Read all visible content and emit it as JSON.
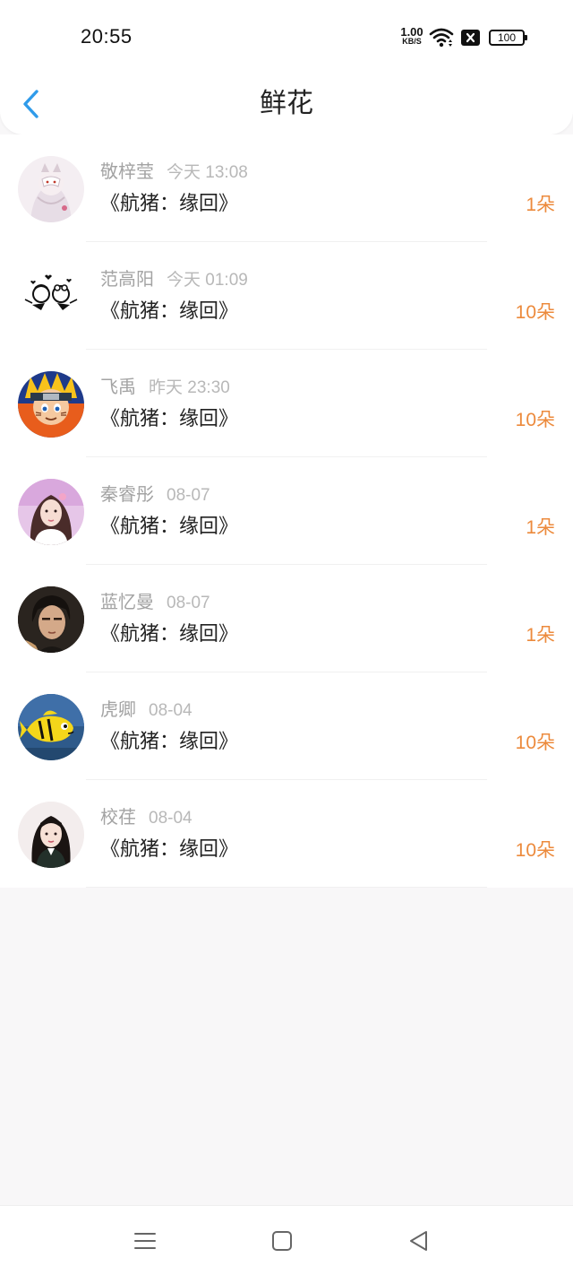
{
  "status_bar": {
    "time": "20:55",
    "net_speed_value": "1.00",
    "net_speed_unit": "KB/S",
    "battery": "100",
    "icons": [
      "wifi-icon",
      "sim-no-signal-icon",
      "battery-icon"
    ]
  },
  "header": {
    "title": "鲜花",
    "back_icon": "chevron-left-icon"
  },
  "colors": {
    "accent": "#2f9bea",
    "count": "#ec8a3c",
    "title_text": "#222222",
    "meta_text": "#a3a3a3",
    "background": "#f8f7f8"
  },
  "items": [
    {
      "name": "敬梓莹",
      "time": "今天 13:08",
      "title": "《航猪：缘回》",
      "count": "1朵",
      "avatar": "avatar-girl-fox-mask"
    },
    {
      "name": "范高阳",
      "time": "今天 01:09",
      "title": "《航猪：缘回》",
      "count": "10朵",
      "avatar": "avatar-cartoon-kissing-couple"
    },
    {
      "name": "飞禹",
      "time": "昨天 23:30",
      "title": "《航猪：缘回》",
      "count": "10朵",
      "avatar": "avatar-naruto"
    },
    {
      "name": "秦睿彤",
      "time": "08-07",
      "title": "《航猪：缘回》",
      "count": "1朵",
      "avatar": "avatar-girl-pink"
    },
    {
      "name": "蓝忆曼",
      "time": "08-07",
      "title": "《航猪：缘回》",
      "count": "1朵",
      "avatar": "avatar-young-man"
    },
    {
      "name": "虎卿",
      "time": "08-04",
      "title": "《航猪：缘回》",
      "count": "10朵",
      "avatar": "avatar-yellow-fish"
    },
    {
      "name": "校荏",
      "time": "08-04",
      "title": "《航猪：缘回》",
      "count": "10朵",
      "avatar": "avatar-girl-portrait"
    }
  ],
  "nav": {
    "icons": [
      "menu-icon",
      "home-square-icon",
      "back-triangle-icon"
    ]
  }
}
